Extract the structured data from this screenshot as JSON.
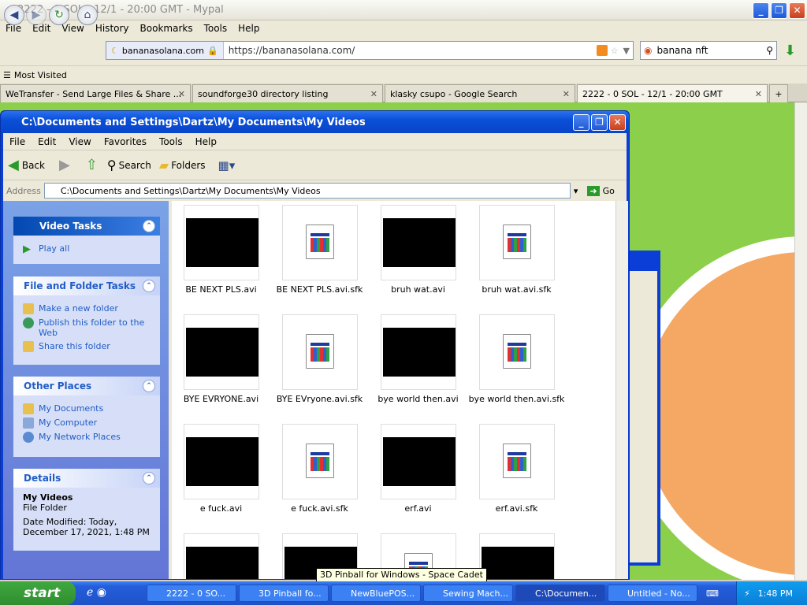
{
  "firefox": {
    "window_title": "2222 - 0 SOL - 12/1 - 20:00 GMT - Mypal",
    "menu": [
      "File",
      "Edit",
      "View",
      "History",
      "Bookmarks",
      "Tools",
      "Help"
    ],
    "site_badge": "bananasolana.com",
    "url": "https://bananasolana.com/",
    "search_value": "banana nft",
    "bookmark": "Most Visited",
    "tabs": [
      {
        "label": "WeTransfer - Send Large Files & Share ...",
        "active": false
      },
      {
        "label": "soundforge30 directory listing",
        "active": false
      },
      {
        "label": "klasky csupo - Google Search",
        "active": false
      },
      {
        "label": "2222 - 0 SOL - 12/1 - 20:00 GMT",
        "active": true
      }
    ],
    "new_tab": "+"
  },
  "explorer": {
    "title": "C:\\Documents and Settings\\Dartz\\My Documents\\My Videos",
    "menu": [
      "File",
      "Edit",
      "View",
      "Favorites",
      "Tools",
      "Help"
    ],
    "toolbar": {
      "back": "Back",
      "search": "Search",
      "folders": "Folders"
    },
    "address_label": "Address",
    "address": "C:\\Documents and Settings\\Dartz\\My Documents\\My Videos",
    "go": "Go",
    "video_tasks": {
      "title": "Video Tasks",
      "items": [
        "Play all"
      ]
    },
    "file_tasks": {
      "title": "File and Folder Tasks",
      "items": [
        "Make a new folder",
        "Publish this folder to the Web",
        "Share this folder"
      ]
    },
    "other_places": {
      "title": "Other Places",
      "items": [
        "My Documents",
        "My Computer",
        "My Network Places"
      ]
    },
    "details": {
      "title": "Details",
      "name": "My Videos",
      "type": "File Folder",
      "modified": "Date Modified: Today, December 17, 2021, 1:48 PM"
    },
    "files": [
      {
        "name": "BE NEXT PLS.avi",
        "kind": "video"
      },
      {
        "name": "BE NEXT PLS.avi.sfk",
        "kind": "doc"
      },
      {
        "name": "bruh wat.avi",
        "kind": "video"
      },
      {
        "name": "bruh wat.avi.sfk",
        "kind": "doc"
      },
      {
        "name": "BYE EVRYONE.avi",
        "kind": "video"
      },
      {
        "name": "BYE EVryone.avi.sfk",
        "kind": "doc"
      },
      {
        "name": "bye world then.avi",
        "kind": "video"
      },
      {
        "name": "bye world then.avi.sfk",
        "kind": "doc"
      },
      {
        "name": "e fuck.avi",
        "kind": "video"
      },
      {
        "name": "e fuck.avi.sfk",
        "kind": "doc"
      },
      {
        "name": "erf.avi",
        "kind": "video"
      },
      {
        "name": "erf.avi.sfk",
        "kind": "doc"
      }
    ]
  },
  "tooltip": "3D Pinball for Windows - Space Cadet",
  "taskbar": {
    "start": "start",
    "buttons": [
      {
        "label": "2222 - 0 SO...",
        "active": false
      },
      {
        "label": "3D Pinball fo...",
        "active": false
      },
      {
        "label": "NewBluePOS...",
        "active": false
      },
      {
        "label": "Sewing Mach...",
        "active": false
      },
      {
        "label": "C:\\Documen...",
        "active": true
      },
      {
        "label": "Untitled - No...",
        "active": false
      }
    ],
    "clock": "1:48 PM"
  }
}
